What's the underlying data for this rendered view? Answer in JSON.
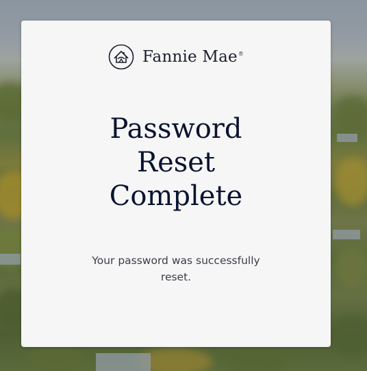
{
  "brand": {
    "name": "Fannie Mae",
    "registered_mark": "®"
  },
  "title_lines": [
    "Password",
    "Reset",
    "Complete"
  ],
  "message": "Your password was successfully reset.",
  "colors": {
    "card_background": "#f6f6f6",
    "title_text": "#0a1330",
    "body_text": "#3a3d48"
  },
  "icons": {
    "logo": "fannie-mae-house-logo-icon"
  }
}
